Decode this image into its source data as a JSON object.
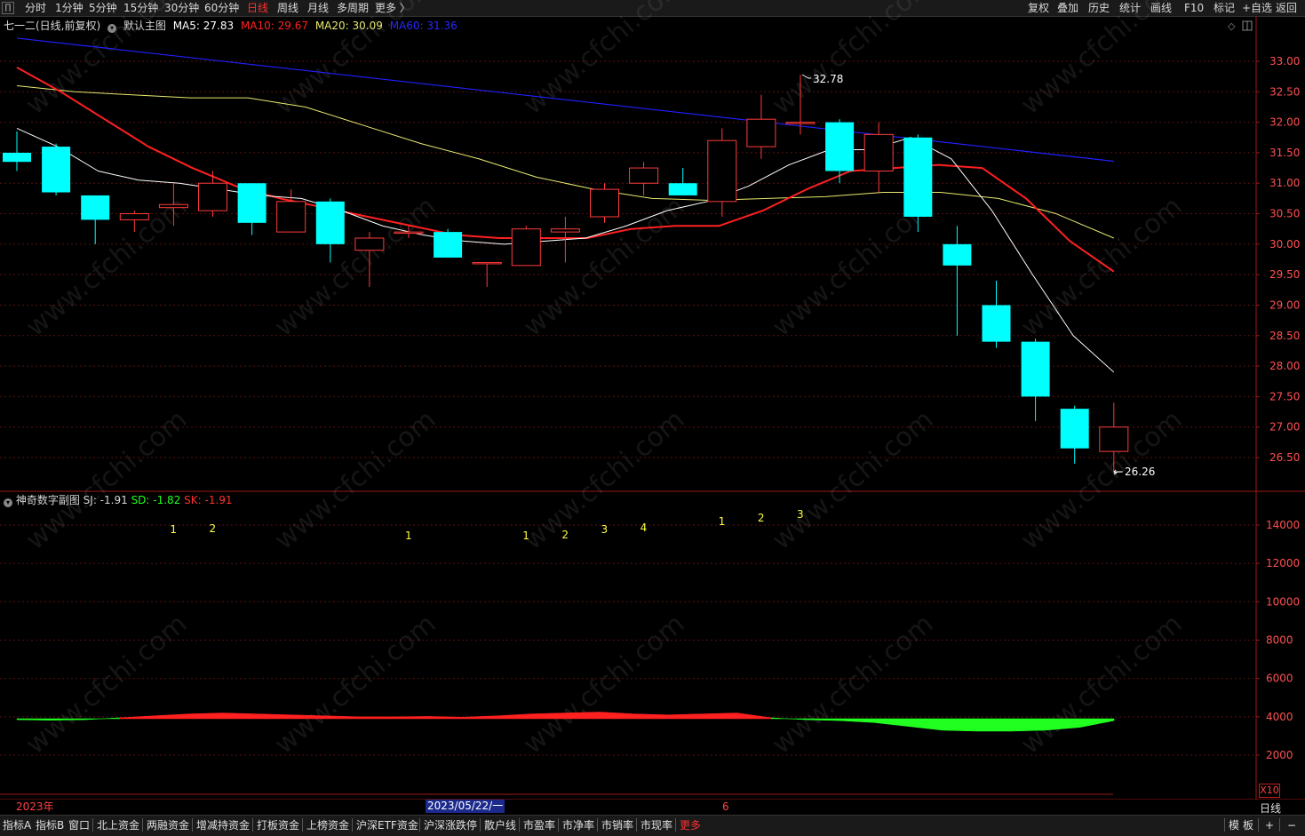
{
  "toolbar": {
    "left": [
      "分时",
      "1分钟",
      "5分钟",
      "15分钟",
      "30分钟",
      "60分钟",
      "日线",
      "周线",
      "月线",
      "多周期",
      "更多 〉"
    ],
    "active": "日线",
    "right": [
      "复权",
      "叠加",
      "历史",
      "统计",
      "画线",
      "F10",
      "标记",
      "+自选",
      "返回"
    ]
  },
  "main_legend": {
    "title": "七一二(日线,前复权)",
    "template": "默认主图",
    "ma5": "MA5: 27.83",
    "ma10": "MA10: 29.67",
    "ma20": "MA20: 30.09",
    "ma60": "MA60: 31.36"
  },
  "sub_legend": {
    "title": "神奇数字副图",
    "sj": "SJ: -1.91",
    "sd": "SD: -1.82",
    "sk": "SK: -1.91"
  },
  "price_axis": [
    "33.00",
    "32.50",
    "32.00",
    "31.50",
    "31.00",
    "30.50",
    "30.00",
    "29.50",
    "29.00",
    "28.50",
    "28.00",
    "27.50",
    "27.00",
    "26.50"
  ],
  "sub_axis": [
    "14000",
    "12000",
    "10000",
    "8000",
    "6000",
    "4000",
    "2000"
  ],
  "annotations": {
    "high": "32.78",
    "low": "26.26"
  },
  "date_axis": {
    "left": "2023年",
    "cursor": "2023/05/22/一",
    "mark": "6"
  },
  "period_label": "日线",
  "scale_badge": "X10",
  "bottom_tabs": [
    "指标A",
    "指标B",
    "窗口",
    "北上资金",
    "两融资金",
    "增减持资金",
    "打板资金",
    "上榜资金",
    "沪深ETF资金",
    "沪深涨跌停",
    "散户线",
    "市盈率",
    "市净率",
    "市销率",
    "市现率",
    "更多"
  ],
  "bottom_right": [
    "模",
    "板",
    "+",
    "−"
  ],
  "colors": {
    "up": "#ff3b3b",
    "down": "#00ffff",
    "ma5": "#ffffff",
    "ma10": "#ff2020",
    "ma20": "#e8e870",
    "ma60": "#2020ff",
    "digits": "#ffff40"
  },
  "chart_data": {
    "type": "candlestick",
    "y_range": [
      26.0,
      33.3
    ],
    "candles": [
      {
        "o": 31.5,
        "c": 31.35,
        "h": 31.85,
        "l": 31.2
      },
      {
        "o": 31.6,
        "c": 30.85,
        "h": 31.65,
        "l": 30.8
      },
      {
        "o": 30.8,
        "c": 30.4,
        "h": 30.8,
        "l": 30.0
      },
      {
        "o": 30.4,
        "c": 30.5,
        "h": 30.55,
        "l": 30.2
      },
      {
        "o": 30.6,
        "c": 30.65,
        "h": 31.0,
        "l": 30.3
      },
      {
        "o": 30.55,
        "c": 31.0,
        "h": 31.2,
        "l": 30.45
      },
      {
        "o": 31.0,
        "c": 30.35,
        "h": 31.0,
        "l": 30.15
      },
      {
        "o": 30.2,
        "c": 30.7,
        "h": 30.9,
        "l": 30.2
      },
      {
        "o": 30.7,
        "c": 30.0,
        "h": 30.75,
        "l": 29.7
      },
      {
        "o": 29.9,
        "c": 30.1,
        "h": 30.2,
        "l": 29.3
      },
      {
        "o": 30.2,
        "c": 30.2,
        "h": 30.3,
        "l": 30.1
      },
      {
        "o": 30.2,
        "c": 29.78,
        "h": 30.25,
        "l": 29.78
      },
      {
        "o": 29.7,
        "c": 29.7,
        "h": 29.7,
        "l": 29.3
      },
      {
        "o": 29.65,
        "c": 30.25,
        "h": 30.3,
        "l": 29.65
      },
      {
        "o": 30.2,
        "c": 30.25,
        "h": 30.45,
        "l": 29.7
      },
      {
        "o": 30.45,
        "c": 30.9,
        "h": 31.0,
        "l": 30.35
      },
      {
        "o": 31.0,
        "c": 31.25,
        "h": 31.35,
        "l": 30.8
      },
      {
        "o": 31.0,
        "c": 30.8,
        "h": 31.25,
        "l": 30.8
      },
      {
        "o": 30.7,
        "c": 31.7,
        "h": 31.9,
        "l": 30.45
      },
      {
        "o": 31.6,
        "c": 32.05,
        "h": 32.45,
        "l": 31.4
      },
      {
        "o": 32.0,
        "c": 32.0,
        "h": 32.78,
        "l": 31.8
      },
      {
        "o": 32.0,
        "c": 31.2,
        "h": 32.05,
        "l": 31.0
      },
      {
        "o": 31.2,
        "c": 31.8,
        "h": 32.0,
        "l": 30.85
      },
      {
        "o": 31.75,
        "c": 30.45,
        "h": 31.8,
        "l": 30.2
      },
      {
        "o": 30.0,
        "c": 29.65,
        "h": 30.3,
        "l": 28.5
      },
      {
        "o": 29.0,
        "c": 28.4,
        "h": 29.4,
        "l": 28.3
      },
      {
        "o": 28.4,
        "c": 27.5,
        "h": 28.45,
        "l": 27.1
      },
      {
        "o": 27.3,
        "c": 26.65,
        "h": 27.35,
        "l": 26.4
      },
      {
        "o": 26.6,
        "c": 27.0,
        "h": 27.4,
        "l": 26.26
      }
    ],
    "ma5": [
      31.9,
      31.6,
      31.2,
      31.05,
      31.0,
      30.9,
      30.8,
      30.75,
      30.55,
      30.3,
      30.15,
      30.05,
      30.0,
      30.05,
      30.1,
      30.3,
      30.55,
      30.7,
      30.95,
      31.3,
      31.55,
      31.55,
      31.75,
      31.4,
      30.55,
      29.5,
      28.5,
      27.9
    ],
    "ma10": [
      32.9,
      32.5,
      32.05,
      31.6,
      31.25,
      30.95,
      30.75,
      30.6,
      30.45,
      30.3,
      30.15,
      30.1,
      30.1,
      30.1,
      30.25,
      30.3,
      30.3,
      30.55,
      30.9,
      31.2,
      31.25,
      31.3,
      31.25,
      30.75,
      30.05,
      29.55
    ],
    "ma20": [
      32.6,
      32.5,
      32.45,
      32.4,
      32.4,
      32.25,
      31.95,
      31.65,
      31.4,
      31.1,
      30.9,
      30.75,
      30.72,
      30.75,
      30.78,
      30.85,
      30.85,
      30.75,
      30.5,
      30.1
    ],
    "ma60": [
      33.38,
      31.36
    ],
    "digits": [
      {
        "i": 4,
        "label": "1"
      },
      {
        "i": 5,
        "label": "2"
      },
      {
        "i": 10,
        "label": "1"
      },
      {
        "i": 13,
        "label": "1"
      },
      {
        "i": 14,
        "label": "2"
      },
      {
        "i": 15,
        "label": "3"
      },
      {
        "i": 16,
        "label": "4"
      },
      {
        "i": 18,
        "label": "1"
      },
      {
        "i": 19,
        "label": "2"
      },
      {
        "i": 20,
        "label": "3"
      }
    ],
    "sub_series": [
      3850,
      3820,
      3850,
      3950,
      4050,
      4150,
      4200,
      4150,
      4100,
      4050,
      4000,
      4000,
      4020,
      3980,
      4050,
      4150,
      4200,
      4250,
      4150,
      4100,
      4150,
      4200,
      3950,
      3850,
      3800,
      3700,
      3500,
      3300,
      3250,
      3250,
      3300,
      3450,
      3800
    ]
  }
}
